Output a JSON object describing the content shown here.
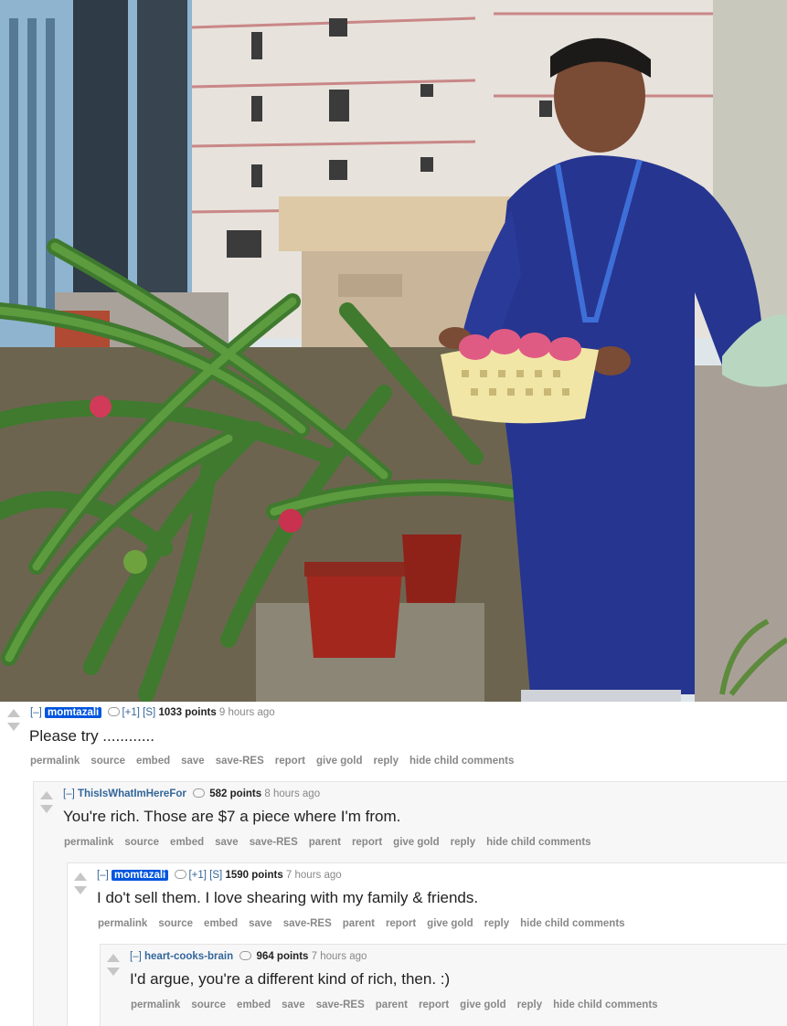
{
  "comments": [
    {
      "collapse": "[–]",
      "author": "momtazali",
      "flair_count": "[+1]",
      "user_attr": "[S]",
      "points": "1033 points",
      "time": "9 hours ago",
      "body": "Please try ............",
      "buttons": [
        "permalink",
        "source",
        "embed",
        "save",
        "save-RES",
        "report",
        "give gold",
        "reply",
        "hide child comments"
      ]
    },
    {
      "collapse": "[–]",
      "author": "ThisIsWhatImHereFor",
      "points": "582 points",
      "time": "8 hours ago",
      "body": "You're rich. Those are $7 a piece where I'm from.",
      "buttons": [
        "permalink",
        "source",
        "embed",
        "save",
        "save-RES",
        "parent",
        "report",
        "give gold",
        "reply",
        "hide child comments"
      ]
    },
    {
      "collapse": "[–]",
      "author": "momtazali",
      "flair_count": "[+1]",
      "user_attr": "[S]",
      "points": "1590 points",
      "time": "7 hours ago",
      "body": "I do't sell them. I love shearing with my family & friends.",
      "buttons": [
        "permalink",
        "source",
        "embed",
        "save",
        "save-RES",
        "parent",
        "report",
        "give gold",
        "reply",
        "hide child comments"
      ]
    },
    {
      "collapse": "[–]",
      "author": "heart-cooks-brain",
      "points": "964 points",
      "time": "7 hours ago",
      "body": "I'd argue, you're a different kind of rich, then. :)",
      "buttons": [
        "permalink",
        "source",
        "embed",
        "save",
        "save-RES",
        "parent",
        "report",
        "give gold",
        "reply",
        "hide child comments"
      ]
    }
  ],
  "colors": {
    "author_link": "#336699",
    "op_badge": "#0055df",
    "arrow": "#c6c6c6",
    "nested_bg": "#f7f7f8"
  },
  "icons": {
    "vote_up": "upvote-arrow-icon",
    "vote_down": "downvote-arrow-icon",
    "flair": "speech-bubble-icon"
  }
}
